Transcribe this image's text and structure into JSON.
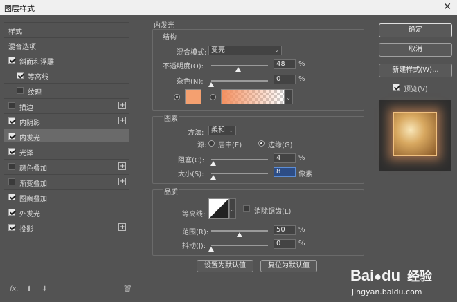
{
  "window": {
    "title": "图层样式",
    "close_glyph": "✕"
  },
  "sidebar": {
    "items": [
      {
        "label": "样式",
        "checkbox": null,
        "plus": false,
        "selected": false,
        "indent": 0
      },
      {
        "label": "混合选项",
        "checkbox": null,
        "plus": false,
        "selected": false,
        "indent": 0
      },
      {
        "label": "斜面和浮雕",
        "checkbox": true,
        "plus": false,
        "selected": false,
        "indent": 0
      },
      {
        "label": "等高线",
        "checkbox": true,
        "plus": false,
        "selected": false,
        "indent": 1
      },
      {
        "label": "纹理",
        "checkbox": false,
        "plus": false,
        "selected": false,
        "indent": 1
      },
      {
        "label": "描边",
        "checkbox": false,
        "plus": true,
        "selected": false,
        "indent": 0
      },
      {
        "label": "内阴影",
        "checkbox": true,
        "plus": true,
        "selected": false,
        "indent": 0
      },
      {
        "label": "内发光",
        "checkbox": true,
        "plus": false,
        "selected": true,
        "indent": 0
      },
      {
        "label": "光泽",
        "checkbox": true,
        "plus": false,
        "selected": false,
        "indent": 0
      },
      {
        "label": "颜色叠加",
        "checkbox": false,
        "plus": true,
        "selected": false,
        "indent": 0
      },
      {
        "label": "渐变叠加",
        "checkbox": false,
        "plus": true,
        "selected": false,
        "indent": 0
      },
      {
        "label": "图案叠加",
        "checkbox": true,
        "plus": false,
        "selected": false,
        "indent": 0
      },
      {
        "label": "外发光",
        "checkbox": true,
        "plus": false,
        "selected": false,
        "indent": 0
      },
      {
        "label": "投影",
        "checkbox": true,
        "plus": true,
        "selected": false,
        "indent": 0
      }
    ],
    "footer": {
      "fx_label": "fx.",
      "up_glyph": "⬆",
      "down_glyph": "⬇",
      "trash_glyph": "🗑"
    }
  },
  "panel": {
    "title": "内发光",
    "structure": {
      "heading": "结构",
      "blend_mode_label": "混合模式:",
      "blend_mode_value": "变亮",
      "opacity_label": "不透明度(O):",
      "opacity_value": "48",
      "opacity_fraction": 0.48,
      "noise_label": "杂色(N):",
      "noise_value": "0",
      "noise_fraction": 0.0,
      "percent": "%",
      "color_swatch": "#f4a070",
      "gradient_start": "#f49060"
    },
    "elements": {
      "heading": "图素",
      "method_label": "方法:",
      "method_value": "柔和",
      "source_label": "源:",
      "source_center_label": "居中(E)",
      "source_edge_label": "边缘(G)",
      "choke_label": "阻塞(C):",
      "choke_value": "4",
      "choke_fraction": 0.04,
      "size_label": "大小(S):",
      "size_value": "8",
      "size_unit": "像素",
      "size_fraction": 0.032,
      "percent": "%"
    },
    "quality": {
      "heading": "品质",
      "contour_label": "等高线:",
      "antialias_label": "消除锯齿(L)",
      "range_label": "范围(R):",
      "range_value": "50",
      "range_fraction": 0.5,
      "jitter_label": "抖动(J):",
      "jitter_value": "0",
      "jitter_fraction": 0.0,
      "percent": "%"
    },
    "buttons": {
      "make_default": "设置为默认值",
      "reset_default": "复位为默认值"
    }
  },
  "right": {
    "ok": "确定",
    "cancel": "取消",
    "new_style": "新建样式(W)...",
    "preview_label": "预览(V)"
  },
  "watermark": {
    "brand": "Bai",
    "brand2": "du",
    "jingyan": "经验",
    "url": "jingyan.baidu.com"
  }
}
